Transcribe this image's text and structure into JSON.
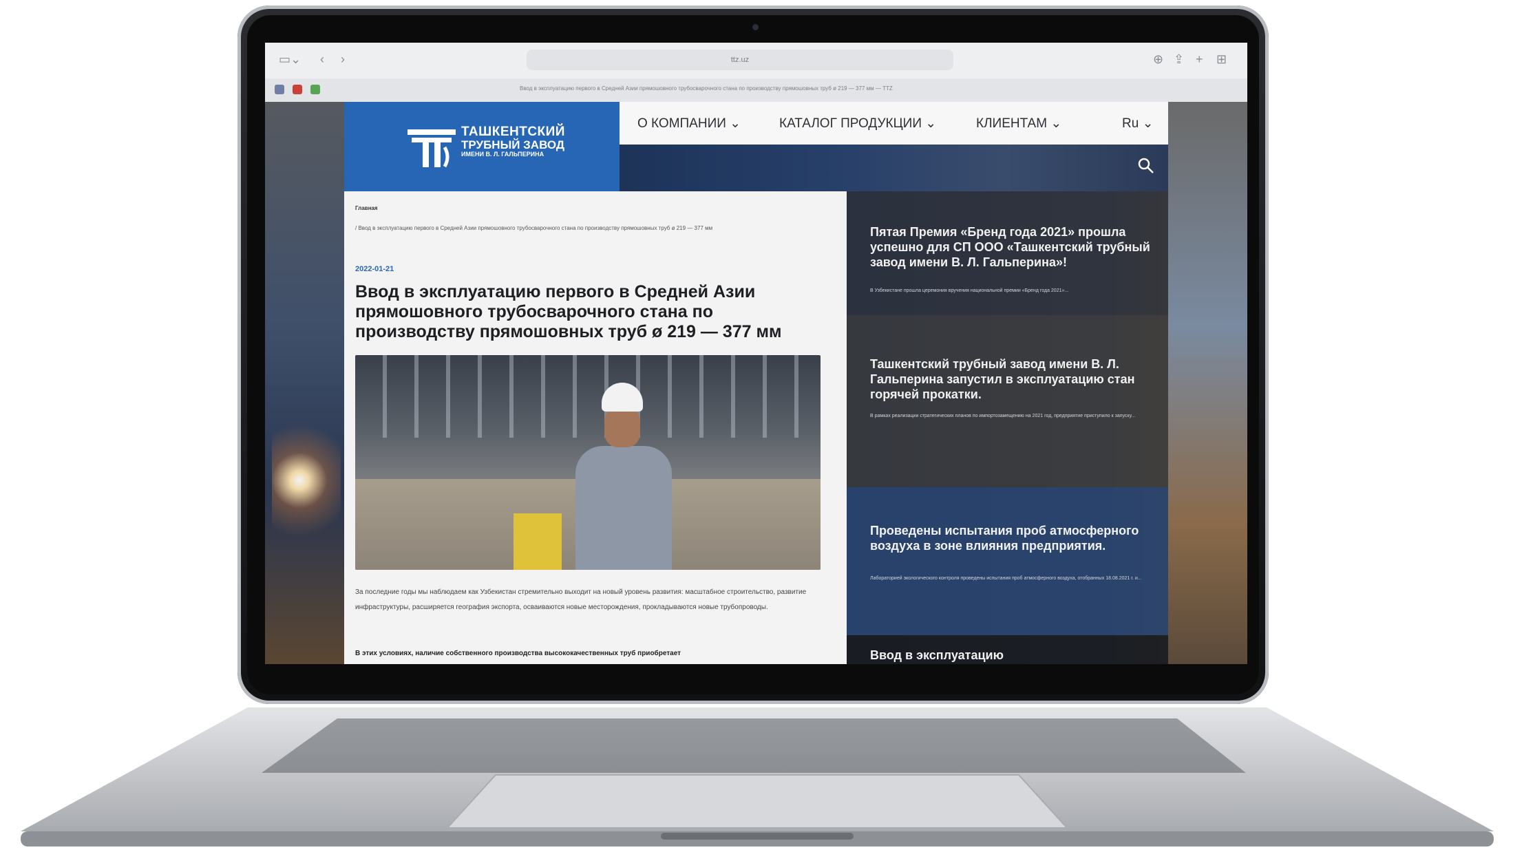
{
  "browser": {
    "address": "ttz.uz",
    "tab_title": "Ввод в эксплуатацию первого в Средней Азии прямошовного трубосварочного стана по производству прямошовных труб ø 219 — 377 мм — TTZ"
  },
  "site": {
    "logo": {
      "line1": "ТАШКЕНТСКИЙ",
      "line2": "ТРУБНЫЙ ЗАВОД",
      "line3": "ИМЕНИ В. Л. ГАЛЬПЕРИНА"
    },
    "nav": [
      {
        "label": "О КОМПАНИИ ⌄"
      },
      {
        "label": "КАТАЛОГ ПРОДУКЦИИ ⌄"
      },
      {
        "label": "КЛИЕНТАМ ⌄"
      },
      {
        "label": "Ru ⌄"
      }
    ]
  },
  "article": {
    "breadcrumb_root": "Главная",
    "breadcrumb_path": "/ Ввод в эксплуатацию первого в Средней Азии прямошовного трубосварочного стана по производству прямошовных труб ø 219 — 377 мм",
    "date": "2022-01-21",
    "title": "Ввод в эксплуатацию первого в Средней Азии прямошовного трубосварочного стана по производству прямошовных труб ø 219 — 377 мм",
    "paragraph1": "За последние годы мы наблюдаем как Узбекистан стремительно выходит на новый уровень развития: масштабное строительство, развитие инфраструктуры, расширяется география экспорта, осваиваются новые месторождения, прокладываются новые трубопроводы.",
    "paragraph2": "В этих условиях, наличие собственного производства высококачественных труб приобретает"
  },
  "news": [
    {
      "title": "Пятая Премия «Бренд года 2021» прошла успешно для СП ООО «Ташкентский трубный завод имени В. Л. Гальперина»!",
      "text": "В Узбекистане прошла церемония вручения национальной премии «Бренд года 2021»..."
    },
    {
      "title": "Ташкентский трубный завод имени В. Л. Гальперина запустил в эксплуатацию стан горячей прокатки.",
      "text": "В рамках реализации стратегических планов по импортозамещению на 2021 год, предприятие приступило к запуску..."
    },
    {
      "title": "Проведены испытания проб атмосферного воздуха в зоне влияния предприятия.",
      "text": "Лабораторией экологического контроля проведены испытания проб атмосферного воздуха, отобранных 18.08.2021 г. и..."
    },
    {
      "title": "Ввод в эксплуатацию",
      "text": ""
    }
  ],
  "colors": {
    "brand": "#2666b4",
    "accent_date": "#2666b4"
  }
}
